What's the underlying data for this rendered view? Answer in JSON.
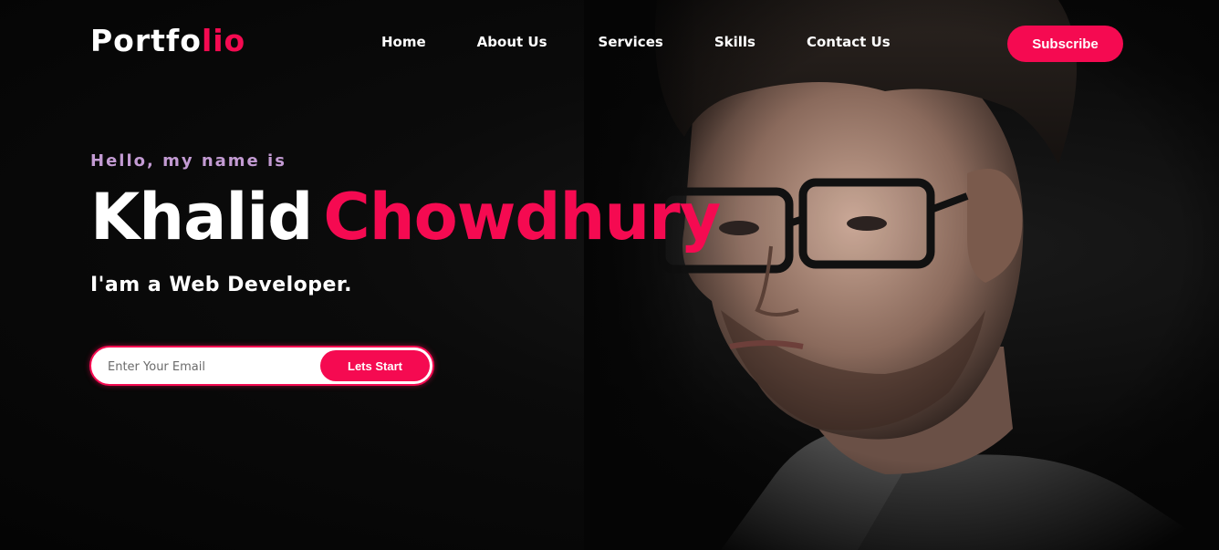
{
  "colors": {
    "accent": "#f50a51",
    "background": "#050505",
    "greeting": "#c39bd3",
    "text": "#ffffff"
  },
  "header": {
    "logo_main": "Portfo",
    "logo_accent": "lio",
    "nav": [
      {
        "label": "Home"
      },
      {
        "label": "About Us"
      },
      {
        "label": "Services"
      },
      {
        "label": "Skills"
      },
      {
        "label": "Contact Us"
      }
    ],
    "subscribe_label": "Subscribe"
  },
  "hero": {
    "greeting": "Hello, my name is",
    "first_name": "Khalid",
    "last_name": "Chowdhury",
    "role": "I'am a Web Developer.",
    "email_placeholder": "Enter Your Email",
    "start_label": "Lets Start"
  }
}
